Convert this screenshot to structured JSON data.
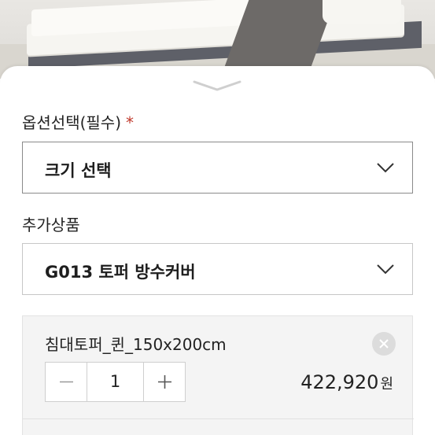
{
  "hero": {
    "image_name": "mattress-topper-photo"
  },
  "options": {
    "label": "옵션선택(필수)",
    "required_mark": "*",
    "size_select": {
      "value": "크기 선택"
    }
  },
  "addons": {
    "label": "추가상품",
    "select": {
      "value": "G013 토퍼 방수커버"
    }
  },
  "selected_item": {
    "name": "침대토퍼_퀸_150x200cm",
    "quantity": "1",
    "price": "422,920",
    "currency": "원"
  },
  "colors": {
    "required": "#c0392b",
    "item_bg": "#f4f4f4"
  }
}
